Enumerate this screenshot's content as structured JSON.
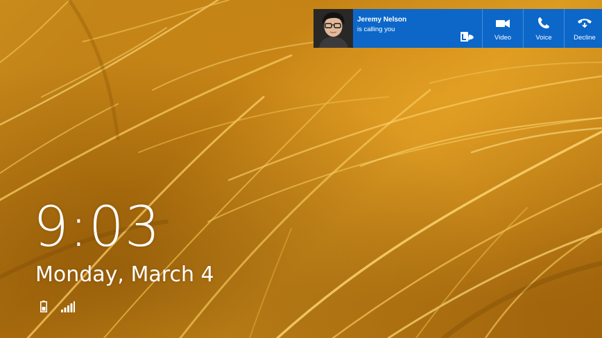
{
  "notification": {
    "caller_name": "Jeremy Nelson",
    "status_text": "is calling you",
    "app_icon": "lync-icon",
    "avatar": "caller-photo",
    "actions": [
      {
        "label": "Video",
        "icon": "video-camera-icon"
      },
      {
        "label": "Voice",
        "icon": "phone-icon"
      },
      {
        "label": "Decline",
        "icon": "hang-up-icon"
      }
    ],
    "background_color": "#0c67c9"
  },
  "lock_screen": {
    "time": "9:03",
    "date": "Monday, March 4",
    "status_icons": [
      "battery-icon",
      "signal-strength-icon"
    ],
    "wallpaper": "golden-grass"
  }
}
